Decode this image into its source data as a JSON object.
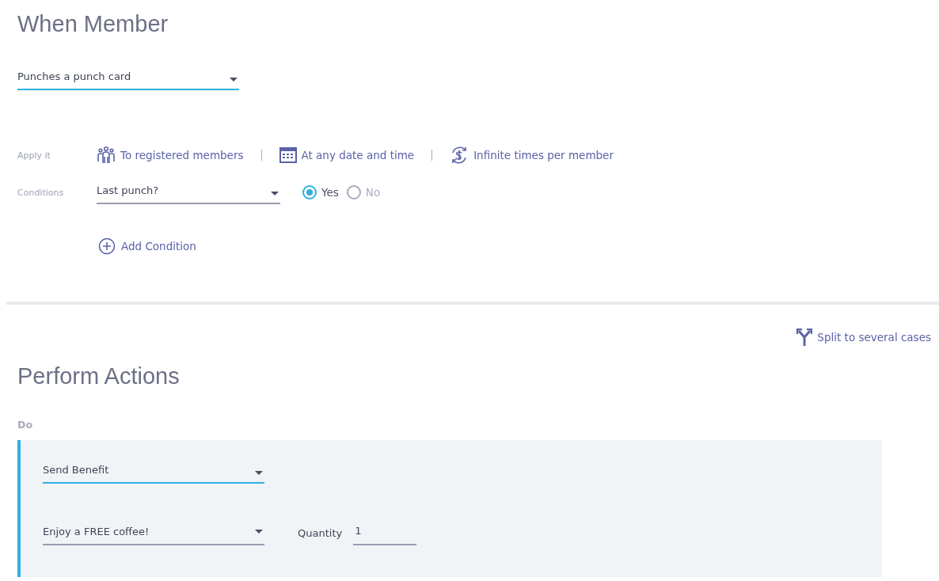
{
  "trigger": {
    "title": "When Member",
    "dropdown": {
      "value": "Punches a punch card",
      "active": true
    }
  },
  "apply": {
    "label": "Apply it",
    "options": [
      {
        "kind": "members",
        "label": "To registered members"
      },
      {
        "kind": "date",
        "label": "At any date and time"
      },
      {
        "kind": "times",
        "label": "Infinite times per member"
      }
    ]
  },
  "conditions": {
    "label": "Conditions",
    "dropdown": {
      "value": "Last punch?",
      "active": false
    },
    "radios": [
      {
        "label": "Yes",
        "selected": true
      },
      {
        "label": "No",
        "selected": false
      }
    ]
  },
  "add_condition": "Add Condition",
  "split_link": "Split to several cases",
  "actions": {
    "title": "Perform Actions",
    "do_label": "Do",
    "action_dropdown": {
      "value": "Send Benefit",
      "active": true
    },
    "benefit_dropdown": {
      "value": "Enjoy a FREE coffee!",
      "active": false
    },
    "quantity_label": "Quantity",
    "quantity_value": "1"
  }
}
